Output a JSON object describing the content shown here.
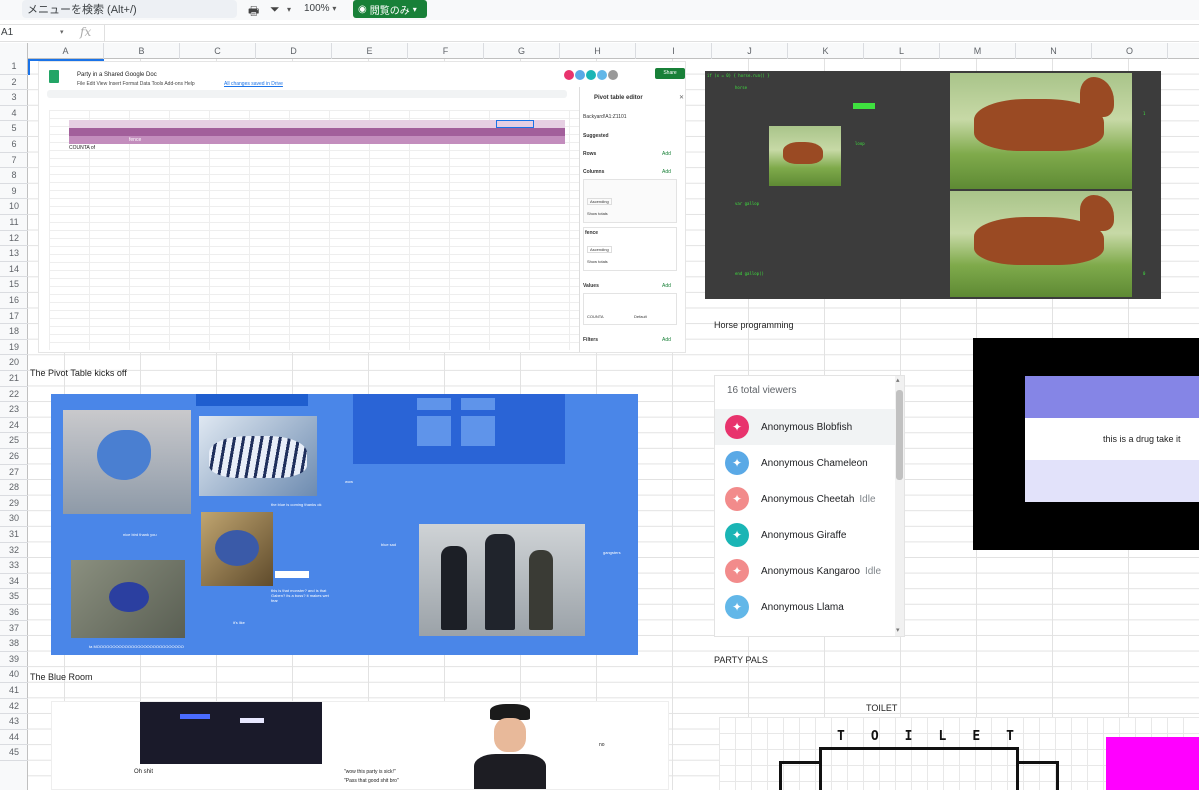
{
  "toolbar": {
    "search_placeholder": "メニューを検索 (Alt+/)",
    "zoom": "100%",
    "view_mode": "閲覧のみ",
    "print_icon": "print-icon",
    "filter_icon": "filter-icon"
  },
  "formula_bar": {
    "cell_ref": "A1",
    "fx": "fx"
  },
  "columns": [
    "A",
    "B",
    "C",
    "D",
    "E",
    "F",
    "G",
    "H",
    "I",
    "J",
    "K",
    "L",
    "M",
    "N",
    "O"
  ],
  "rows": [
    "1",
    "2",
    "3",
    "4",
    "5",
    "6",
    "7",
    "8",
    "9",
    "10",
    "11",
    "12",
    "13",
    "14",
    "15",
    "16",
    "17",
    "18",
    "19",
    "20",
    "21",
    "22",
    "23",
    "24",
    "25",
    "26",
    "27",
    "28",
    "29",
    "30",
    "31",
    "32",
    "33",
    "34",
    "35",
    "36",
    "37",
    "38",
    "39",
    "40",
    "41",
    "42",
    "43",
    "44",
    "45"
  ],
  "cells": {
    "pivot_caption": "The Pivot Table kicks off",
    "horse_caption": "Horse programming",
    "blue_caption": "The Blue Room",
    "party_caption": "PARTY PALS",
    "toilet_caption": "TOILET"
  },
  "pivot_shot": {
    "doc_title": "Party in a Shared Google Doc",
    "saved": "All changes saved in Drive",
    "menu": "File  Edit  View  Insert  Format  Data  Tools  Add-ons  Help",
    "share": "Share",
    "panel_title": "Pivot table editor",
    "range": "Backyard!A1:Z1101",
    "suggested": "Suggested",
    "rows_label": "Rows",
    "columns_label": "Columns",
    "values_label": "Values",
    "filters_label": "Filters",
    "add": "Add",
    "fence": "fence",
    "sum_label": "COUNTA of",
    "order": "Ascending",
    "show_totals": "Show totals",
    "summarize": "COUNTA",
    "default": "Default"
  },
  "blue_room": {
    "dino_note": "this is that monster? and is that Gaben? its a boss? it makes wet fear",
    "bottom_text": "ta MOOOOOOOOOOOOOOOOOOOOOOOOOOOO",
    "note_left": "nice bird thank you",
    "note_blue": "the blue is coming thanks ok",
    "wow": "wow",
    "blue_sad": "blue sad",
    "gangsters": "gangsters",
    "its_like": "it's like"
  },
  "party_pals": {
    "title": "16 total viewers",
    "viewers": [
      {
        "name": "Anonymous Blobfish",
        "idle": "",
        "color": "#e8336d"
      },
      {
        "name": "Anonymous Chameleon",
        "idle": "",
        "color": "#5aa9e6"
      },
      {
        "name": "Anonymous Cheetah",
        "idle": "Idle",
        "color": "#f28b8b"
      },
      {
        "name": "Anonymous Giraffe",
        "idle": "",
        "color": "#1ab5b5"
      },
      {
        "name": "Anonymous Kangaroo",
        "idle": "Idle",
        "color": "#f28b8b"
      },
      {
        "name": "Anonymous Llama",
        "idle": "",
        "color": "#62b7e8"
      }
    ]
  },
  "drug": {
    "text": "this is a drug take it"
  },
  "police": {
    "oh_shit": "Oh shit",
    "quote1": "\"wow this party is sick!\"",
    "quote2": "\"Pass that good shit bro\"",
    "no": "no"
  },
  "toilet": {
    "letters": [
      "T",
      "O",
      "I",
      "L",
      "E",
      "T"
    ]
  },
  "colors": {
    "accent_green": "#188038",
    "blue_room": "#4a86e8",
    "magenta": "#ff00ff",
    "pivot_purple": "#a25f9b"
  }
}
